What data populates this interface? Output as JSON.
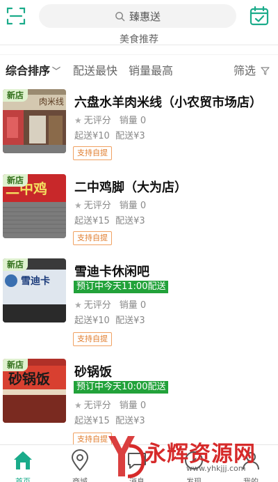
{
  "header": {
    "search_text": "臻惠送",
    "subbanner": "美食推荐"
  },
  "sortbar": {
    "items": [
      {
        "label": "综合排序",
        "active": true
      },
      {
        "label": "配送最快",
        "active": false
      },
      {
        "label": "销量最高",
        "active": false
      }
    ],
    "filter_label": "筛选"
  },
  "shops": [
    {
      "badge": "新店",
      "name": "六盘水羊肉米线（小农贸市场店）",
      "preorder": "",
      "rating": "无评分",
      "sales": "销量 0",
      "min_order": "起送¥10",
      "delivery_fee": "配送¥3",
      "pickup": "支持自提",
      "sign_text": "肉米线"
    },
    {
      "badge": "新店",
      "name": "二中鸡脚（大为店）",
      "preorder": "",
      "rating": "无评分",
      "sales": "销量 0",
      "min_order": "起送¥15",
      "delivery_fee": "配送¥3",
      "pickup": "支持自提",
      "sign_text": "二中鸡"
    },
    {
      "badge": "新店",
      "name": "雪迪卡休闲吧",
      "preorder": "预订中今天11:00配送",
      "rating": "无评分",
      "sales": "销量 0",
      "min_order": "起送¥10",
      "delivery_fee": "配送¥3",
      "pickup": "支持自提",
      "sign_text": "雪迪卡"
    },
    {
      "badge": "新店",
      "name": "砂锅饭",
      "preorder": "预订中今天10:00配送",
      "rating": "无评分",
      "sales": "销量 0",
      "min_order": "起送¥15",
      "delivery_fee": "配送¥3",
      "pickup": "支持自提",
      "sign_text": "砂锅饭"
    }
  ],
  "tabbar": {
    "items": [
      {
        "label": "首页",
        "icon": "home-icon",
        "active": true
      },
      {
        "label": "商城",
        "icon": "location-icon",
        "active": false
      },
      {
        "label": "消息",
        "icon": "message-icon",
        "active": false
      },
      {
        "label": "发现",
        "icon": "discover-icon",
        "active": false
      },
      {
        "label": "我的",
        "icon": "profile-icon",
        "active": false
      }
    ]
  },
  "watermark": {
    "text": "永辉资源网",
    "url": "www.yhkjjj.com"
  },
  "colors": {
    "accent": "#1aab8a",
    "preorder_green": "#22a23a",
    "pickup_orange": "#e07c2c",
    "watermark_red": "#d62a2a"
  }
}
